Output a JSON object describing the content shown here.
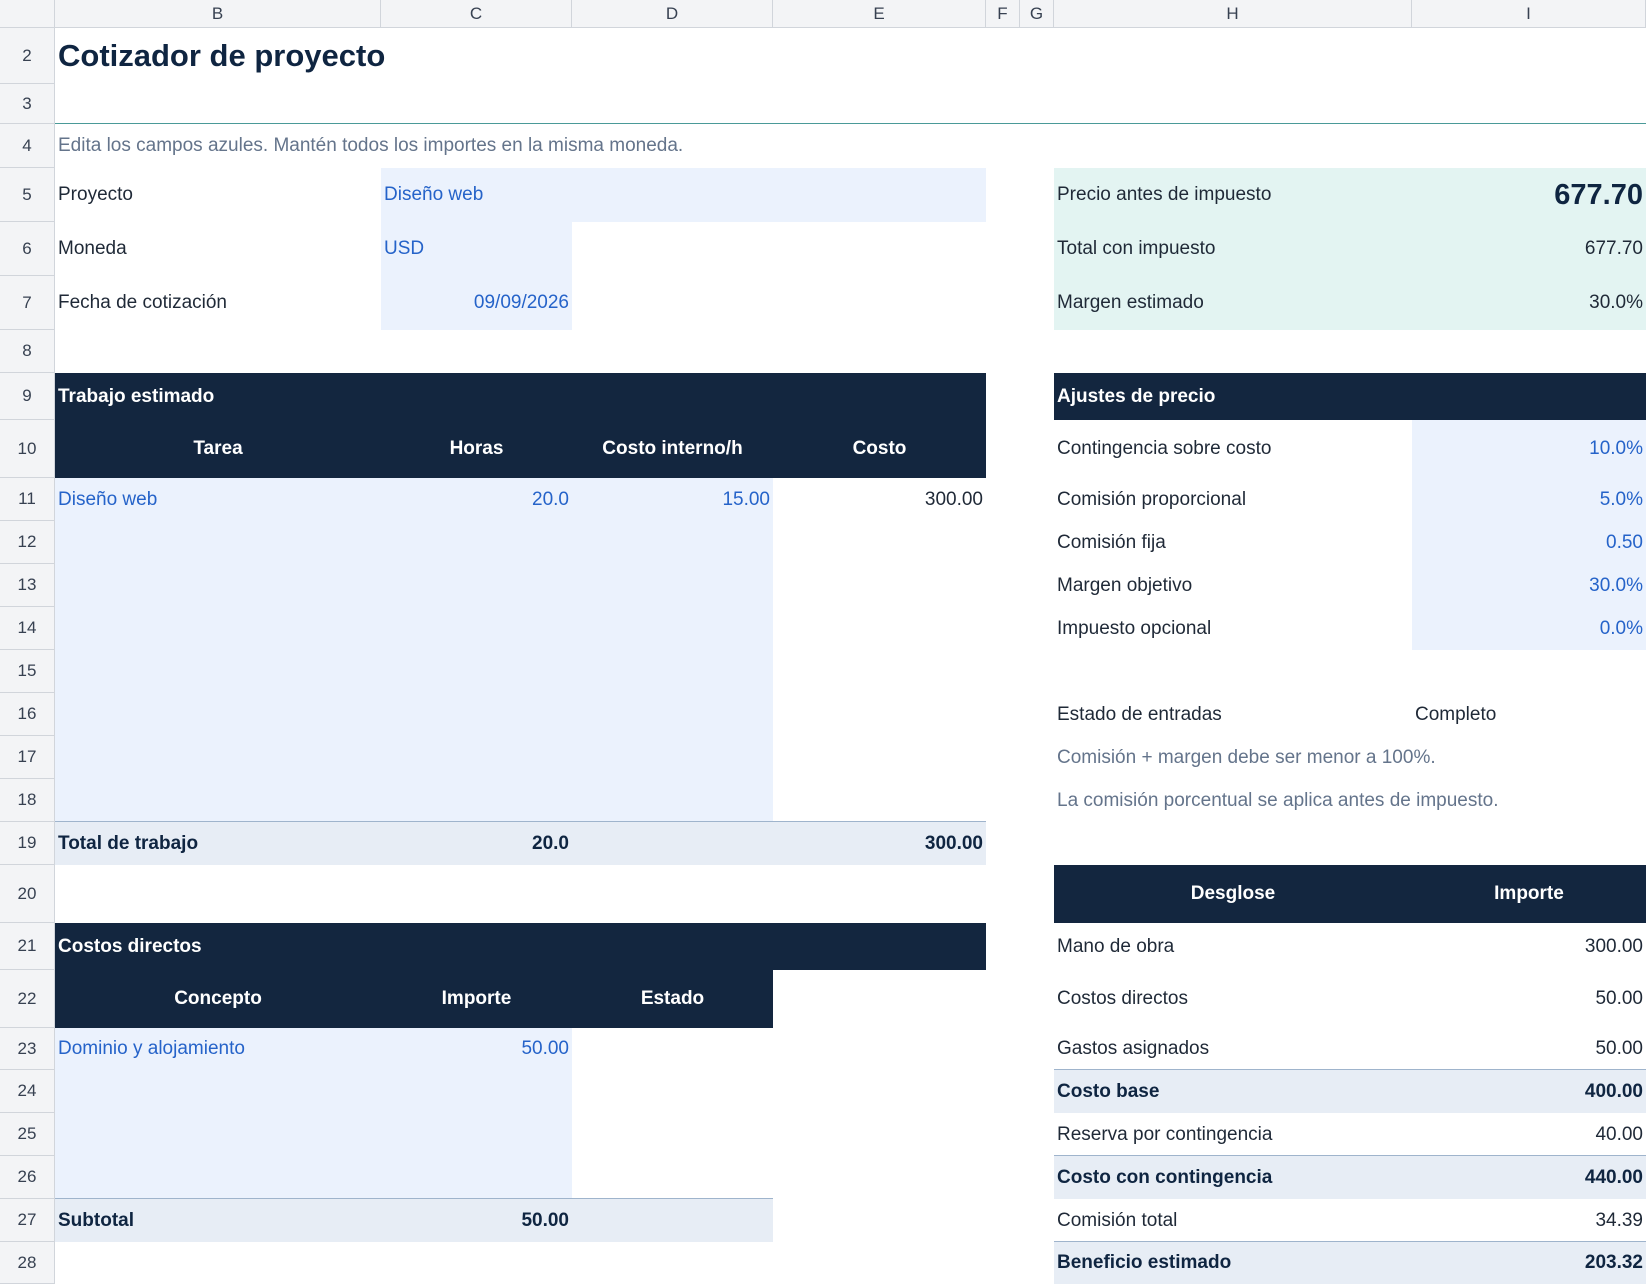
{
  "columns": [
    "B",
    "C",
    "D",
    "E",
    "F",
    "G",
    "H",
    "I"
  ],
  "rows": [
    "2",
    "3",
    "4",
    "5",
    "6",
    "7",
    "8",
    "9",
    "10",
    "11",
    "12",
    "13",
    "14",
    "15",
    "16",
    "17",
    "18",
    "19",
    "20",
    "21",
    "22",
    "23",
    "24",
    "25",
    "26",
    "27",
    "28"
  ],
  "sheet": {
    "title": "Cotizador de proyecto",
    "instructions": "Edita los campos azules. Mantén todos los importes en la misma moneda."
  },
  "project": {
    "project_label": "Proyecto",
    "project_value": "Diseño web",
    "currency_label": "Moneda",
    "currency_value": "USD",
    "date_label": "Fecha de cotización",
    "date_value": "09/09/2026"
  },
  "summary": {
    "price_label": "Precio antes de impuesto",
    "price_value": "677.70",
    "total_label": "Total con impuesto",
    "total_value": "677.70",
    "margin_label": "Margen estimado",
    "margin_value": "30.0%"
  },
  "work": {
    "section_title": "Trabajo estimado",
    "headers": [
      "Tarea",
      "Horas",
      "Costo interno/h",
      "Costo"
    ],
    "rows": [
      {
        "task": "Diseño web",
        "hours": "20.0",
        "rate": "15.00",
        "cost": "300.00"
      }
    ],
    "total_label": "Total de trabajo",
    "total_hours": "20.0",
    "total_cost": "300.00"
  },
  "direct": {
    "section_title": "Costos directos",
    "headers": [
      "Concepto",
      "Importe",
      "Estado"
    ],
    "rows": [
      {
        "concept": "Dominio y alojamiento",
        "amount": "50.00",
        "status": ""
      }
    ],
    "subtotal_label": "Subtotal",
    "subtotal_value": "50.00"
  },
  "adjustments": {
    "section_title": "Ajustes de precio",
    "items": [
      {
        "label": "Contingencia sobre costo",
        "value": "10.0%"
      },
      {
        "label": "Comisión proporcional",
        "value": "5.0%"
      },
      {
        "label": "Comisión fija",
        "value": "0.50"
      },
      {
        "label": "Margen objetivo",
        "value": "30.0%"
      },
      {
        "label": "Impuesto opcional",
        "value": "0.0%"
      }
    ],
    "status_label": "Estado de entradas",
    "status_value": "Completo",
    "note1": "Comisión + margen debe ser menor a 100%.",
    "note2": "La comisión porcentual se aplica antes de impuesto."
  },
  "breakdown": {
    "headers": [
      "Desglose",
      "Importe"
    ],
    "rows": [
      {
        "label": "Mano de obra",
        "value": "300.00"
      },
      {
        "label": "Costos directos",
        "value": "50.00"
      },
      {
        "label": "Gastos asignados",
        "value": "50.00"
      },
      {
        "label": "Costo base",
        "value": "400.00"
      },
      {
        "label": "Reserva por contingencia",
        "value": "40.00"
      },
      {
        "label": "Costo con contingencia",
        "value": "440.00"
      },
      {
        "label": "Comisión total",
        "value": "34.39"
      },
      {
        "label": "Beneficio estimado",
        "value": "203.32"
      }
    ]
  },
  "colors": {
    "navy": "#13263f",
    "input_blue": "#2563c9",
    "input_fill": "#ebf2fd",
    "kpi_fill": "#e3f4f2",
    "total_fill": "#e7edf5"
  }
}
